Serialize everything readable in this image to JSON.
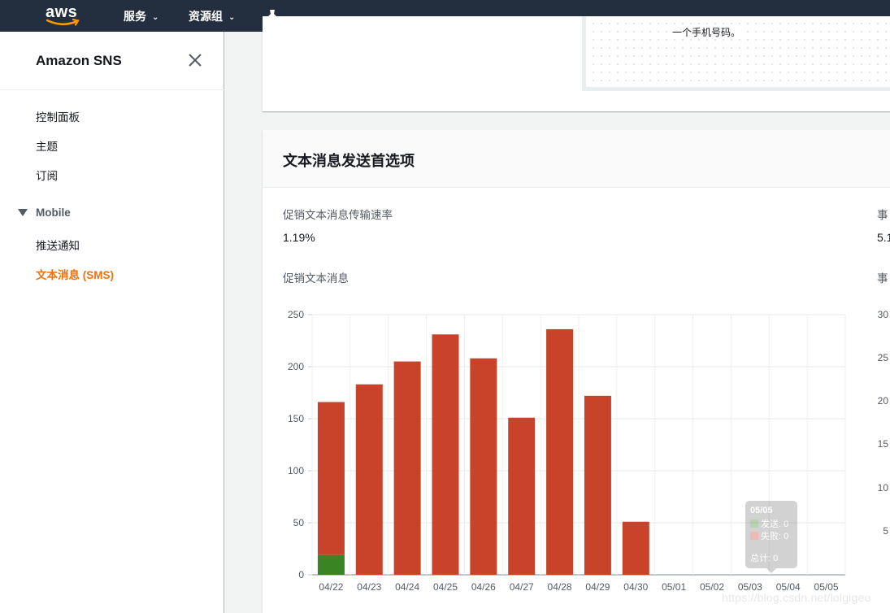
{
  "header": {
    "logo": "aws",
    "services_label": "服务",
    "resource_groups_label": "资源组",
    "pin_icon": "pin-icon"
  },
  "sidebar": {
    "title": "Amazon SNS",
    "items": [
      {
        "label": "控制面板",
        "active": false
      },
      {
        "label": "主题",
        "active": false
      },
      {
        "label": "订阅",
        "active": false
      }
    ],
    "section": {
      "label": "Mobile",
      "items": [
        {
          "label": "推送通知",
          "active": false
        },
        {
          "label": "文本消息 (SMS)",
          "active": true
        }
      ]
    }
  },
  "top_panel": {
    "partial_text": "一个手机号码。"
  },
  "sms_panel": {
    "title": "文本消息发送首选项",
    "rate_label": "促销文本消息传输速率",
    "rate_value": "1.19%",
    "chart_label": "促销文本消息",
    "right_label_partial": "事",
    "right_value_partial": "5.1",
    "right_chart_label_partial": "事"
  },
  "tooltip": {
    "date": "05/05",
    "sent": "发送: 0",
    "failed": "失败: 0",
    "total": "总计: 0"
  },
  "watermark": "https://blog.csdn.net/lolgigeo",
  "colors": {
    "failed": "#c9432b",
    "sent": "#3a8424",
    "nav_bg": "#232f3e",
    "accent": "#ec7211"
  },
  "chart_data": {
    "type": "bar",
    "stacked": true,
    "categories": [
      "04/22",
      "04/23",
      "04/24",
      "04/25",
      "04/26",
      "04/27",
      "04/28",
      "04/29",
      "04/30",
      "05/01",
      "05/02",
      "05/03",
      "05/04",
      "05/05"
    ],
    "series": [
      {
        "name": "发送",
        "values": [
          19,
          0,
          0,
          0,
          0,
          0,
          0,
          0,
          0,
          0,
          0,
          0,
          0,
          0
        ]
      },
      {
        "name": "失败",
        "values": [
          147,
          183,
          205,
          231,
          208,
          151,
          236,
          172,
          51,
          0,
          0,
          0,
          0,
          0
        ]
      }
    ],
    "ylim": [
      0,
      250
    ],
    "yticks": [
      0,
      50,
      100,
      150,
      200,
      250
    ],
    "grid": true
  },
  "right_chart": {
    "yticks_partial": [
      "30",
      "25",
      "20",
      "15",
      "10",
      "5"
    ]
  }
}
